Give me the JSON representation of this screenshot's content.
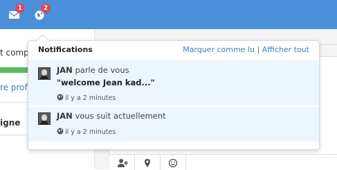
{
  "topbar": {
    "messages_badge": "1",
    "notifications_badge": "2"
  },
  "background": {
    "profile_progress_text": "t compl",
    "profile_link_text": "re profi",
    "section_label": "igne"
  },
  "notifications": {
    "title": "Notifications",
    "mark_read": "Marquer comme lu",
    "separator": "|",
    "show_all": "Afficher tout",
    "items": [
      {
        "user": "JAN",
        "text": " parle de vous",
        "quote": "\"welcome Jean kad...\"",
        "time": "il y a 2 minutes"
      },
      {
        "user": "JAN",
        "text": " vous suit actuellement",
        "time": "il y a 2 minutes"
      }
    ]
  },
  "colors": {
    "topbar": "#4a90d9",
    "badge": "#e0445b",
    "link": "#3d7fc6",
    "unread_bg": "#eef6fd",
    "progress": "#5cb85c"
  },
  "icons": [
    "envelope-icon",
    "globe-icon",
    "avatar",
    "add-user-icon",
    "map-marker-icon",
    "smiley-icon"
  ]
}
